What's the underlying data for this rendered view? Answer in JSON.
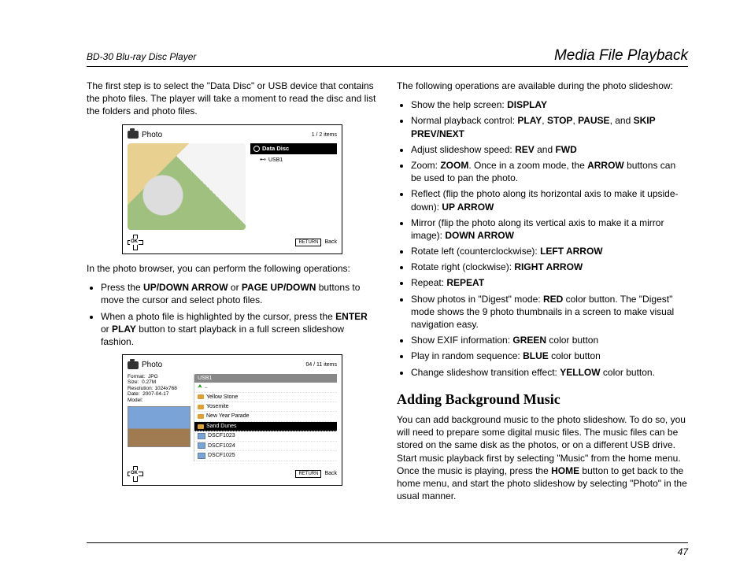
{
  "header": {
    "left": "BD-30 Blu-ray Disc Player",
    "right": "Media File Playback"
  },
  "left_col": {
    "intro": "The first step is to select the \"Data Disc\" or USB device that contains the photo files. The player will take a moment to read the disc and list the folders and photo files.",
    "panel1": {
      "title": "Photo",
      "count": "1 / 2 items",
      "list_header": "Data Disc",
      "list_sub": "USB1",
      "ok": "OK",
      "return": "RETURN",
      "back": "Back"
    },
    "ops_intro": "In the photo browser, you can perform the following operations:",
    "op1_a": "Press the ",
    "op1_b": "UP/DOWN ARROW",
    "op1_c": " or ",
    "op1_d": "PAGE UP/DOWN",
    "op1_e": " buttons to move the cursor and select photo files.",
    "op2_a": "When a photo file is highlighted by the cursor, press the ",
    "op2_b": "ENTER",
    "op2_c": " or ",
    "op2_d": "PLAY",
    "op2_e": " button to start playback in a full screen slideshow fashion.",
    "panel2": {
      "title": "Photo",
      "count": "04 / 11 items",
      "meta": {
        "l_format": "Format:",
        "v_format": "JPG",
        "l_size": "Size:",
        "v_size": "0.27M",
        "l_res": "Resolution:",
        "v_res": "1024x768",
        "l_date": "Date:",
        "v_date": "2007-04-17",
        "l_model": "Model:",
        "v_model": ""
      },
      "bc_head": "USB1",
      "up": "..",
      "rows": {
        "r1": "Yellow Stone",
        "r2": "Yosemite",
        "r3": "New Year Parade",
        "r4": "Sand Dunes",
        "r5": "DSCF1023",
        "r6": "DSCF1024",
        "r7": "DSCF1025"
      },
      "ok": "OK",
      "return": "RETURN",
      "back": "Back"
    }
  },
  "right_col": {
    "intro": "The following operations are available during the photo slideshow:",
    "items": {
      "i1a": "Show the help screen: ",
      "i1b": "DISPLAY",
      "i2a": "Normal playback control: ",
      "i2b": "PLAY",
      "i2c": ", ",
      "i2d": "STOP",
      "i2e": ", ",
      "i2f": "PAUSE",
      "i2g": ", and ",
      "i2h": "SKIP PREV/NEXT",
      "i3a": "Adjust slideshow speed: ",
      "i3b": "REV",
      "i3c": " and ",
      "i3d": "FWD",
      "i4a": "Zoom: ",
      "i4b": "ZOOM",
      "i4c": ". Once in a zoom mode, the ",
      "i4d": "ARROW",
      "i4e": " buttons can be used to pan the photo.",
      "i5a": "Reflect (flip the photo along its horizontal axis to make it upside-down): ",
      "i5b": "UP ARROW",
      "i6a": "Mirror (flip the photo along its vertical axis to make it a mirror image): ",
      "i6b": "DOWN ARROW",
      "i7a": "Rotate left (counterclockwise): ",
      "i7b": "LEFT ARROW",
      "i8a": "Rotate right (clockwise): ",
      "i8b": "RIGHT ARROW",
      "i9a": "Repeat: ",
      "i9b": "REPEAT",
      "i10a": "Show photos in \"Digest\" mode: ",
      "i10b": "RED",
      "i10c": " color button. The \"Digest\" mode shows the 9 photo thumbnails in a screen to make visual navigation easy.",
      "i11a": "Show EXIF information: ",
      "i11b": "GREEN",
      "i11c": " color button",
      "i12a": "Play in random sequence: ",
      "i12b": "BLUE",
      "i12c": " color button",
      "i13a": "Change slideshow transition effect: ",
      "i13b": "YELLOW",
      "i13c": " color button."
    },
    "heading": "Adding Background Music",
    "bg_a": "You can add background music to the photo slideshow. To do so, you will need to prepare some digital music files. The music files can be stored on the same disk as the photos, or on a different USB drive. Start music playback first by selecting \"Music\" from the home menu. Once the music is playing, press the ",
    "bg_b": "HOME",
    "bg_c": " button to get back to the home menu, and start the photo slideshow by selecting \"Photo\" in the usual manner."
  },
  "footer": {
    "page": "47"
  }
}
